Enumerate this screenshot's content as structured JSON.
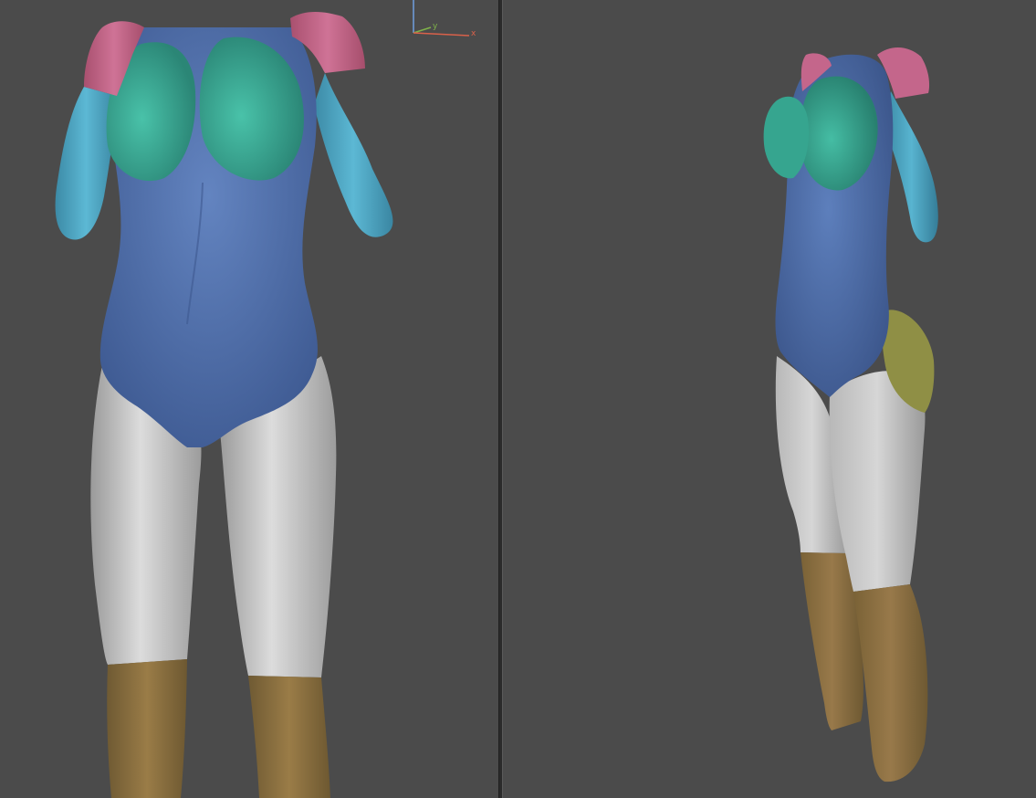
{
  "app": {
    "layout": "split-view",
    "background_color": "#4b4b4b",
    "splitter_color": "#2b2b2b"
  },
  "viewports": [
    {
      "name": "front-view",
      "model": "female-body-mesh",
      "view": "front"
    },
    {
      "name": "three-quarter-view",
      "model": "female-body-mesh",
      "view": "three-quarter"
    }
  ],
  "axis_gizmo": {
    "x_label": "x",
    "y_label": "y",
    "x_color": "#d9614a",
    "y_color": "#7fb24a",
    "z_color": "#6f9fe0"
  },
  "material_groups": [
    {
      "name": "shoulders",
      "color": "#c4668b"
    },
    {
      "name": "chest",
      "color": "#3aa894"
    },
    {
      "name": "torso",
      "color": "#5676b0"
    },
    {
      "name": "arms",
      "color": "#4aa6c4"
    },
    {
      "name": "thighs",
      "color": "#bcbcbc"
    },
    {
      "name": "calves",
      "color": "#8f7342"
    },
    {
      "name": "glutes",
      "color": "#9a9a4a"
    }
  ]
}
